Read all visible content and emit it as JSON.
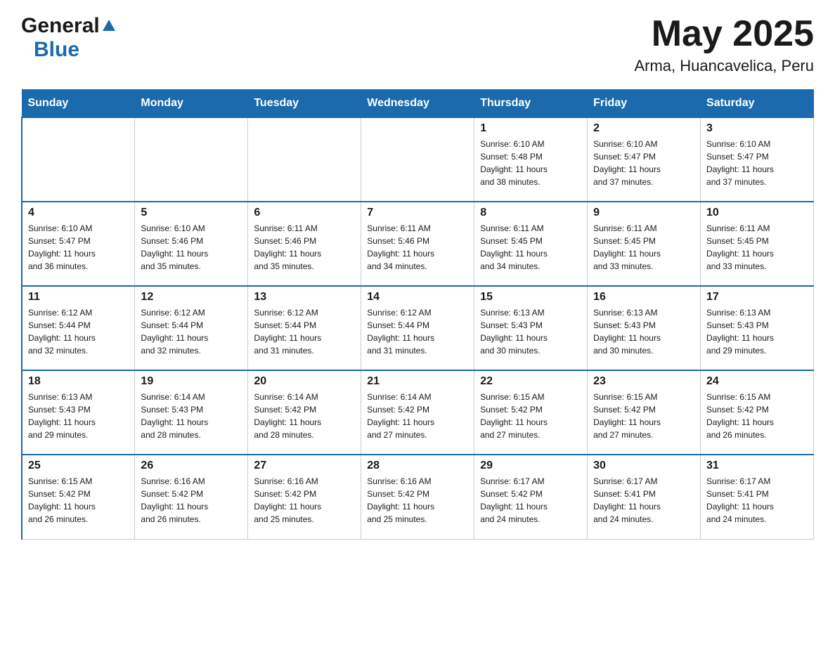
{
  "logo": {
    "general": "General",
    "blue": "Blue",
    "triangle": "▲"
  },
  "header": {
    "month_title": "May 2025",
    "location": "Arma, Huancavelica, Peru"
  },
  "days_of_week": [
    "Sunday",
    "Monday",
    "Tuesday",
    "Wednesday",
    "Thursday",
    "Friday",
    "Saturday"
  ],
  "weeks": [
    [
      {
        "day": "",
        "info": ""
      },
      {
        "day": "",
        "info": ""
      },
      {
        "day": "",
        "info": ""
      },
      {
        "day": "",
        "info": ""
      },
      {
        "day": "1",
        "info": "Sunrise: 6:10 AM\nSunset: 5:48 PM\nDaylight: 11 hours\nand 38 minutes."
      },
      {
        "day": "2",
        "info": "Sunrise: 6:10 AM\nSunset: 5:47 PM\nDaylight: 11 hours\nand 37 minutes."
      },
      {
        "day": "3",
        "info": "Sunrise: 6:10 AM\nSunset: 5:47 PM\nDaylight: 11 hours\nand 37 minutes."
      }
    ],
    [
      {
        "day": "4",
        "info": "Sunrise: 6:10 AM\nSunset: 5:47 PM\nDaylight: 11 hours\nand 36 minutes."
      },
      {
        "day": "5",
        "info": "Sunrise: 6:10 AM\nSunset: 5:46 PM\nDaylight: 11 hours\nand 35 minutes."
      },
      {
        "day": "6",
        "info": "Sunrise: 6:11 AM\nSunset: 5:46 PM\nDaylight: 11 hours\nand 35 minutes."
      },
      {
        "day": "7",
        "info": "Sunrise: 6:11 AM\nSunset: 5:46 PM\nDaylight: 11 hours\nand 34 minutes."
      },
      {
        "day": "8",
        "info": "Sunrise: 6:11 AM\nSunset: 5:45 PM\nDaylight: 11 hours\nand 34 minutes."
      },
      {
        "day": "9",
        "info": "Sunrise: 6:11 AM\nSunset: 5:45 PM\nDaylight: 11 hours\nand 33 minutes."
      },
      {
        "day": "10",
        "info": "Sunrise: 6:11 AM\nSunset: 5:45 PM\nDaylight: 11 hours\nand 33 minutes."
      }
    ],
    [
      {
        "day": "11",
        "info": "Sunrise: 6:12 AM\nSunset: 5:44 PM\nDaylight: 11 hours\nand 32 minutes."
      },
      {
        "day": "12",
        "info": "Sunrise: 6:12 AM\nSunset: 5:44 PM\nDaylight: 11 hours\nand 32 minutes."
      },
      {
        "day": "13",
        "info": "Sunrise: 6:12 AM\nSunset: 5:44 PM\nDaylight: 11 hours\nand 31 minutes."
      },
      {
        "day": "14",
        "info": "Sunrise: 6:12 AM\nSunset: 5:44 PM\nDaylight: 11 hours\nand 31 minutes."
      },
      {
        "day": "15",
        "info": "Sunrise: 6:13 AM\nSunset: 5:43 PM\nDaylight: 11 hours\nand 30 minutes."
      },
      {
        "day": "16",
        "info": "Sunrise: 6:13 AM\nSunset: 5:43 PM\nDaylight: 11 hours\nand 30 minutes."
      },
      {
        "day": "17",
        "info": "Sunrise: 6:13 AM\nSunset: 5:43 PM\nDaylight: 11 hours\nand 29 minutes."
      }
    ],
    [
      {
        "day": "18",
        "info": "Sunrise: 6:13 AM\nSunset: 5:43 PM\nDaylight: 11 hours\nand 29 minutes."
      },
      {
        "day": "19",
        "info": "Sunrise: 6:14 AM\nSunset: 5:43 PM\nDaylight: 11 hours\nand 28 minutes."
      },
      {
        "day": "20",
        "info": "Sunrise: 6:14 AM\nSunset: 5:42 PM\nDaylight: 11 hours\nand 28 minutes."
      },
      {
        "day": "21",
        "info": "Sunrise: 6:14 AM\nSunset: 5:42 PM\nDaylight: 11 hours\nand 27 minutes."
      },
      {
        "day": "22",
        "info": "Sunrise: 6:15 AM\nSunset: 5:42 PM\nDaylight: 11 hours\nand 27 minutes."
      },
      {
        "day": "23",
        "info": "Sunrise: 6:15 AM\nSunset: 5:42 PM\nDaylight: 11 hours\nand 27 minutes."
      },
      {
        "day": "24",
        "info": "Sunrise: 6:15 AM\nSunset: 5:42 PM\nDaylight: 11 hours\nand 26 minutes."
      }
    ],
    [
      {
        "day": "25",
        "info": "Sunrise: 6:15 AM\nSunset: 5:42 PM\nDaylight: 11 hours\nand 26 minutes."
      },
      {
        "day": "26",
        "info": "Sunrise: 6:16 AM\nSunset: 5:42 PM\nDaylight: 11 hours\nand 26 minutes."
      },
      {
        "day": "27",
        "info": "Sunrise: 6:16 AM\nSunset: 5:42 PM\nDaylight: 11 hours\nand 25 minutes."
      },
      {
        "day": "28",
        "info": "Sunrise: 6:16 AM\nSunset: 5:42 PM\nDaylight: 11 hours\nand 25 minutes."
      },
      {
        "day": "29",
        "info": "Sunrise: 6:17 AM\nSunset: 5:42 PM\nDaylight: 11 hours\nand 24 minutes."
      },
      {
        "day": "30",
        "info": "Sunrise: 6:17 AM\nSunset: 5:41 PM\nDaylight: 11 hours\nand 24 minutes."
      },
      {
        "day": "31",
        "info": "Sunrise: 6:17 AM\nSunset: 5:41 PM\nDaylight: 11 hours\nand 24 minutes."
      }
    ]
  ]
}
